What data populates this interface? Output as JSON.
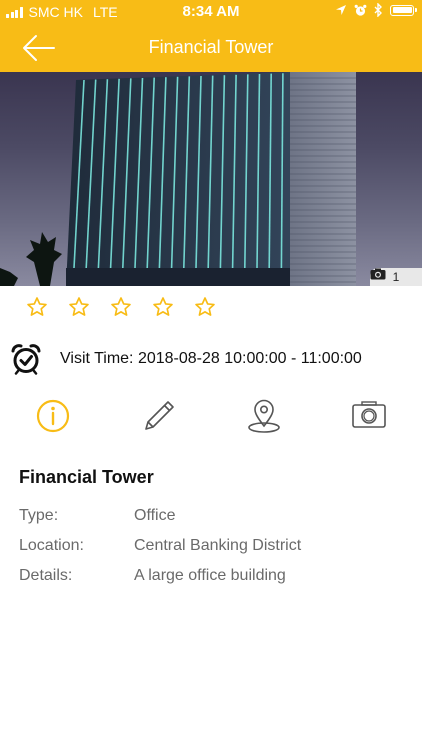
{
  "status_bar": {
    "carrier": "SMC HK",
    "network": "LTE",
    "time": "8:34 AM"
  },
  "header": {
    "title": "Financial Tower",
    "back_icon": "back-arrow-icon"
  },
  "hero": {
    "photo_count": "1",
    "camera_icon": "camera-icon"
  },
  "rating": {
    "stars_total": 5,
    "stars_filled": 0,
    "star_color": "#f8bc16"
  },
  "visit": {
    "icon": "alarm-clock-icon",
    "text": "Visit Time: 2018-08-28 10:00:00 - 11:00:00"
  },
  "actions": [
    {
      "name": "info",
      "icon": "info-icon",
      "active": true
    },
    {
      "name": "edit",
      "icon": "pencil-icon",
      "active": false
    },
    {
      "name": "location",
      "icon": "map-pin-icon",
      "active": false
    },
    {
      "name": "photo",
      "icon": "camera-icon",
      "active": false
    }
  ],
  "details": {
    "title": "Financial Tower",
    "rows": [
      {
        "label": "Type:",
        "value": "Office"
      },
      {
        "label": "Location:",
        "value": "Central Banking District"
      },
      {
        "label": "Details:",
        "value": "A large office building"
      }
    ]
  },
  "colors": {
    "accent": "#f8bc16",
    "header_text": "#ffffff",
    "label_gray": "#6a6a6a",
    "icon_gray": "#555555"
  }
}
